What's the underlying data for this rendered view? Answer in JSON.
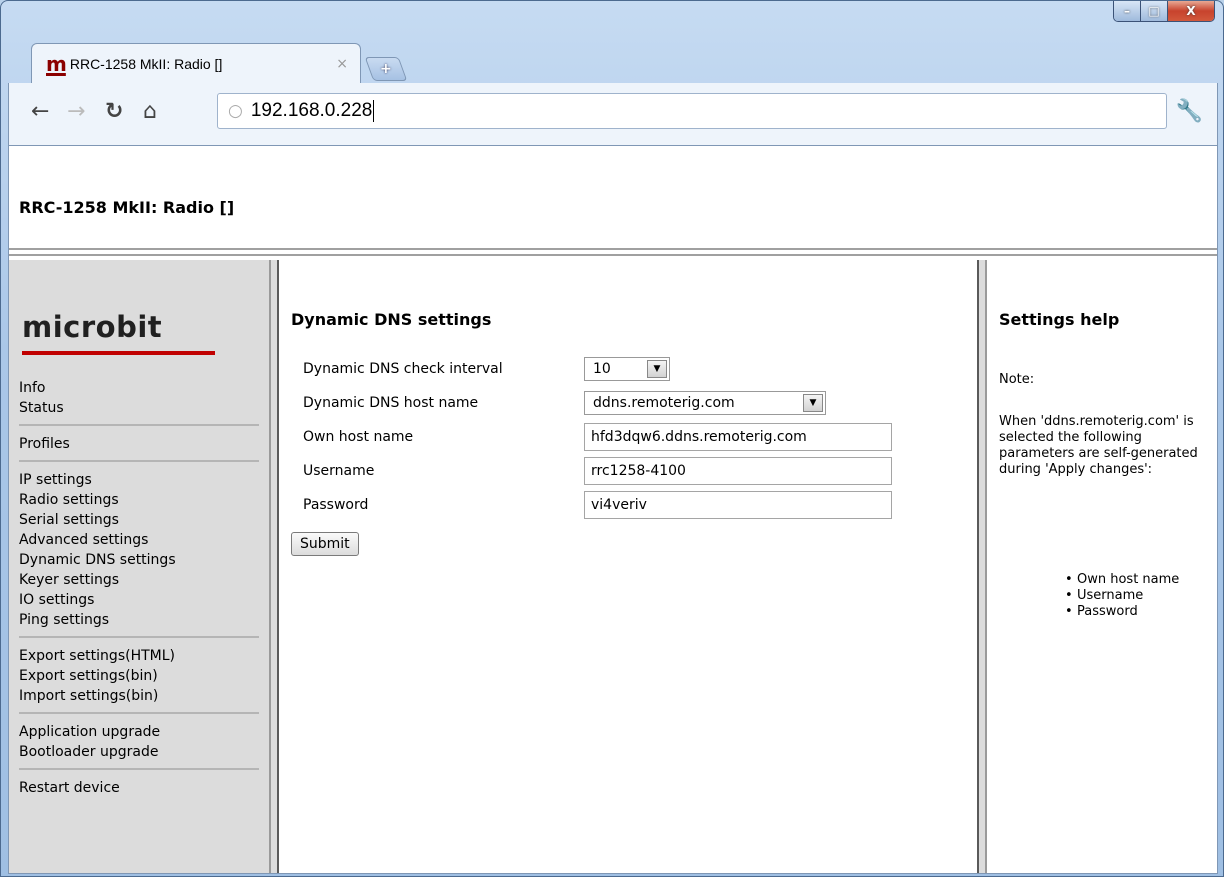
{
  "browser": {
    "tab_title": "RRC-1258 MkII: Radio []",
    "tab_favicon": "m",
    "tab_close": "×",
    "new_tab": "+",
    "url": "192.168.0.228",
    "window_buttons": {
      "minimize": "–",
      "maximize": "□",
      "close": "X"
    }
  },
  "page": {
    "header_title": "RRC-1258 MkII: Radio []"
  },
  "sidebar": {
    "logo": "microbit",
    "groups": [
      {
        "items": [
          "Info",
          "Status"
        ]
      },
      {
        "items": [
          "Profiles"
        ]
      },
      {
        "items": [
          "IP settings",
          "Radio settings",
          "Serial settings",
          "Advanced settings",
          "Dynamic DNS settings",
          "Keyer settings",
          "IO settings",
          "Ping settings"
        ]
      },
      {
        "items": [
          "Export settings(HTML)",
          "Export settings(bin)",
          "Import settings(bin)"
        ]
      },
      {
        "items": [
          "Application upgrade",
          "Bootloader upgrade"
        ]
      },
      {
        "items": [
          "Restart device"
        ]
      }
    ]
  },
  "main": {
    "title": "Dynamic DNS settings",
    "fields": {
      "check_interval": {
        "label": "Dynamic DNS check interval",
        "value": "10"
      },
      "host_name": {
        "label": "Dynamic DNS host name",
        "value": "ddns.remoterig.com"
      },
      "own_host_name": {
        "label": "Own host name",
        "value": "hfd3dqw6.ddns.remoterig.com"
      },
      "username": {
        "label": "Username",
        "value": "rrc1258-4100"
      },
      "password": {
        "label": "Password",
        "value": "vi4veriv"
      }
    },
    "submit_label": "Submit"
  },
  "help": {
    "title": "Settings help",
    "note_label": "Note:",
    "note_text": "When 'ddns.remoterig.com' is selected the following parameters are self-generated during 'Apply changes':",
    "list": [
      "Own host name",
      "Username",
      "Password"
    ]
  }
}
